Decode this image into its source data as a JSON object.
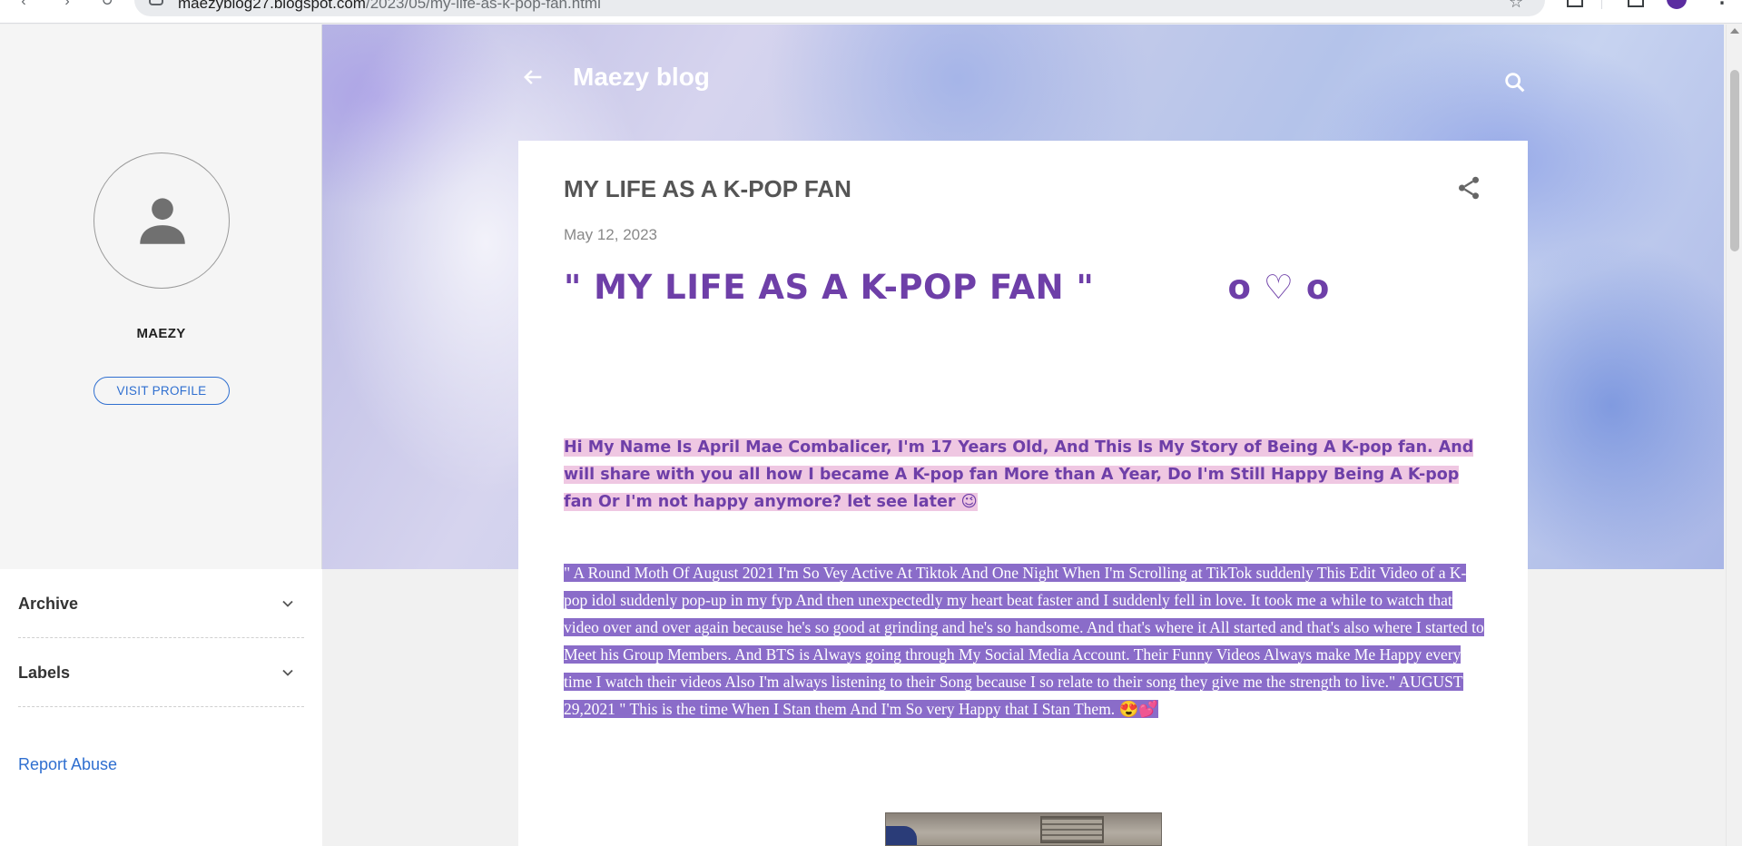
{
  "browser": {
    "url_host": "maezyblog27.blogspot.com",
    "url_path": "/2023/05/my-life-as-k-pop-fan.html"
  },
  "sidebar": {
    "profile_name": "MAEZY",
    "visit_profile_label": "VISIT PROFILE",
    "widgets": [
      {
        "label": "Archive"
      },
      {
        "label": "Labels"
      }
    ],
    "report_abuse_label": "Report Abuse"
  },
  "header": {
    "blog_title": "Maezy blog"
  },
  "post": {
    "title": "MY LIFE AS A K-POP FAN",
    "date": "May 12, 2023",
    "headline": "\" MY LIFE AS A K-POP FAN \"           o ♡ o",
    "intro": "     Hi My Name Is April Mae Combalicer, I'm 17 Years Old, And This Is My Story of Being A K-pop fan. And will share with you all how I became A K-pop fan More than A Year, Do I'm Still Happy Being A K-pop fan Or I'm not happy anymore? let see later 😉",
    "story": "\" A Round Moth Of August 2021 I'm So Vey Active At Tiktok And One Night When I'm Scrolling at TikTok suddenly This Edit Video of a K-pop idol suddenly pop-up in my fyp And then unexpectedly my heart beat faster and I suddenly fell in love. It took me a while to watch that video over and over again because he's so good at grinding and he's so handsome. And that's where it All started and that's also where I started to Meet his Group Members. And BTS is Always going through My Social Media Account. Their Funny Videos Always make Me Happy every time I watch their videos Also I'm always listening to their Song because I so relate to their song they give me the strength to live.\" AUGUST 29,2021 \" This is the time When I Stan them And I'm So very Happy that I Stan Them. 😍💕"
  },
  "colors": {
    "accent_purple": "#6e3fa8",
    "intro_highlight": "#efc7e2",
    "story_highlight": "#8a6cc9",
    "link_blue": "#2f6fd0"
  }
}
